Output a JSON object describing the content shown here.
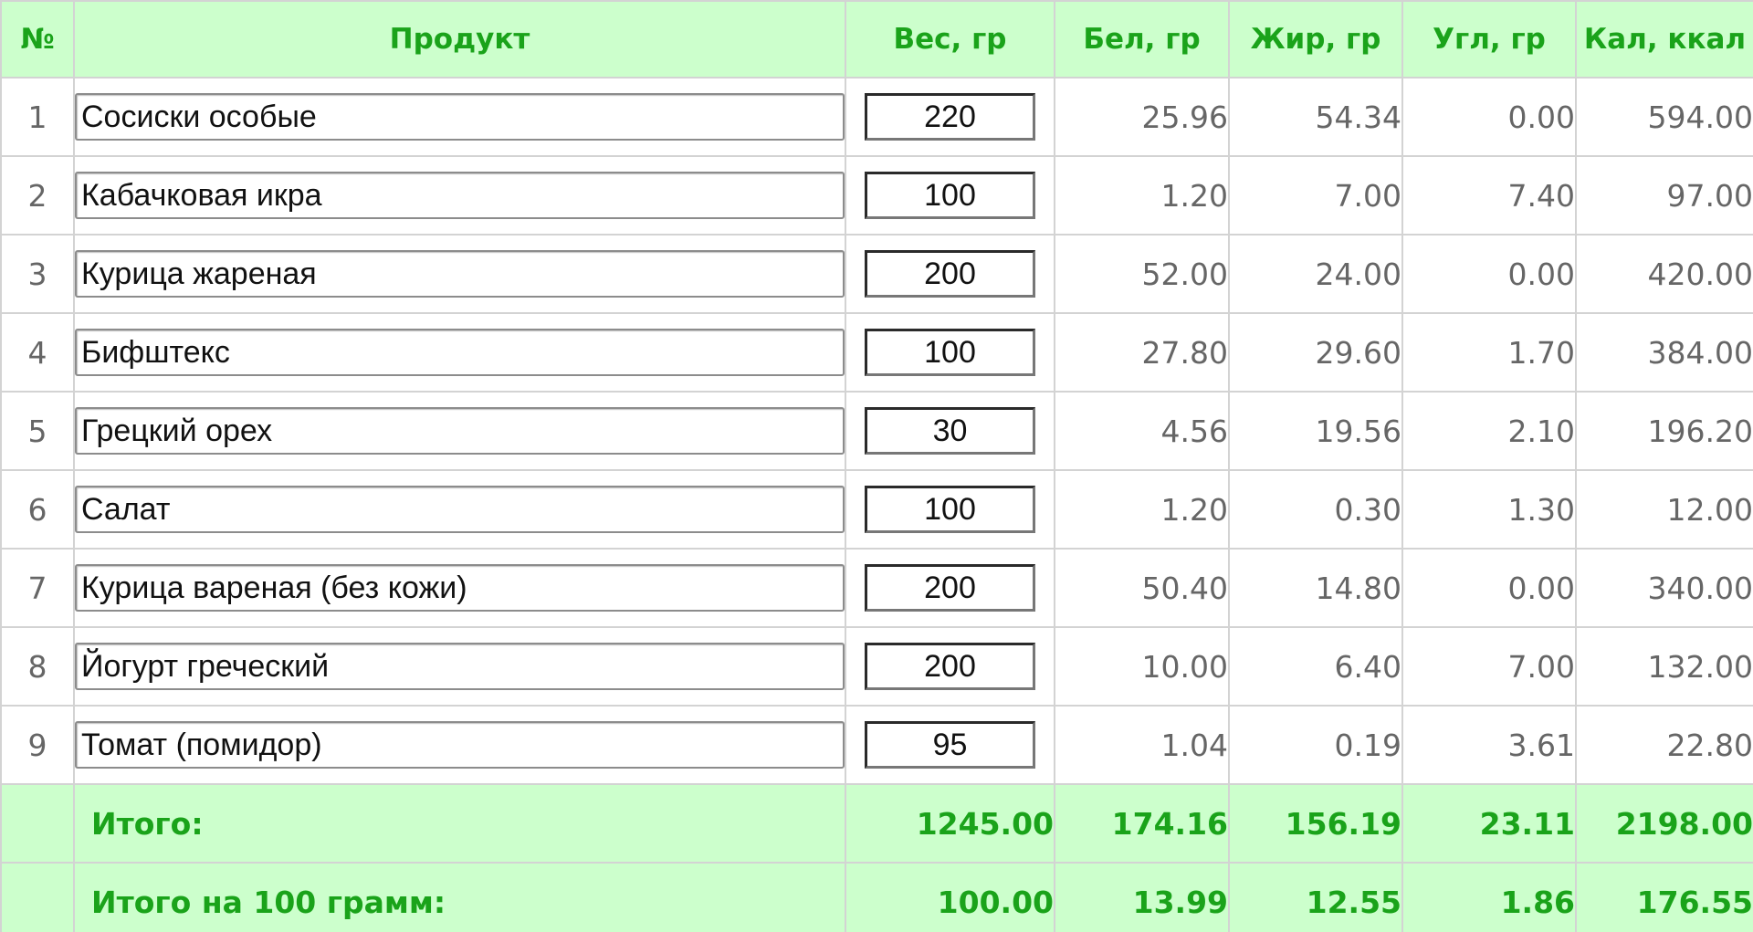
{
  "table": {
    "headers": {
      "num": "№",
      "product": "Продукт",
      "weight": "Вес, гр",
      "protein": "Бел, гр",
      "fat": "Жир, гр",
      "carbs": "Угл, гр",
      "calories": "Кал, ккал"
    },
    "rows": [
      {
        "num": "1",
        "product": "Сосиски особые",
        "weight": "220",
        "protein": "25.96",
        "fat": "54.34",
        "carbs": "0.00",
        "calories": "594.00"
      },
      {
        "num": "2",
        "product": "Кабачковая икра",
        "weight": "100",
        "protein": "1.20",
        "fat": "7.00",
        "carbs": "7.40",
        "calories": "97.00"
      },
      {
        "num": "3",
        "product": "Курица жареная",
        "weight": "200",
        "protein": "52.00",
        "fat": "24.00",
        "carbs": "0.00",
        "calories": "420.00"
      },
      {
        "num": "4",
        "product": "Бифштекс",
        "weight": "100",
        "protein": "27.80",
        "fat": "29.60",
        "carbs": "1.70",
        "calories": "384.00"
      },
      {
        "num": "5",
        "product": "Грецкий орех",
        "weight": "30",
        "protein": "4.56",
        "fat": "19.56",
        "carbs": "2.10",
        "calories": "196.20"
      },
      {
        "num": "6",
        "product": "Салат",
        "weight": "100",
        "protein": "1.20",
        "fat": "0.30",
        "carbs": "1.30",
        "calories": "12.00"
      },
      {
        "num": "7",
        "product": "Курица вареная (без кожи)",
        "weight": "200",
        "protein": "50.40",
        "fat": "14.80",
        "carbs": "0.00",
        "calories": "340.00"
      },
      {
        "num": "8",
        "product": "Йогурт греческий",
        "weight": "200",
        "protein": "10.00",
        "fat": "6.40",
        "carbs": "7.00",
        "calories": "132.00"
      },
      {
        "num": "9",
        "product": "Томат (помидор)",
        "weight": "95",
        "protein": "1.04",
        "fat": "0.19",
        "carbs": "3.61",
        "calories": "22.80"
      }
    ],
    "totals": [
      {
        "label": "Итого:",
        "weight": "1245.00",
        "protein": "174.16",
        "fat": "156.19",
        "carbs": "23.11",
        "calories": "2198.00"
      },
      {
        "label": "Итого на 100 грамм:",
        "weight": "100.00",
        "protein": "13.99",
        "fat": "12.55",
        "carbs": "1.86",
        "calories": "176.55"
      }
    ]
  },
  "colors": {
    "header_bg": "#ccffcc",
    "header_text": "#1aa31a",
    "grid": "#d3d3d3",
    "value_text": "#666666"
  }
}
